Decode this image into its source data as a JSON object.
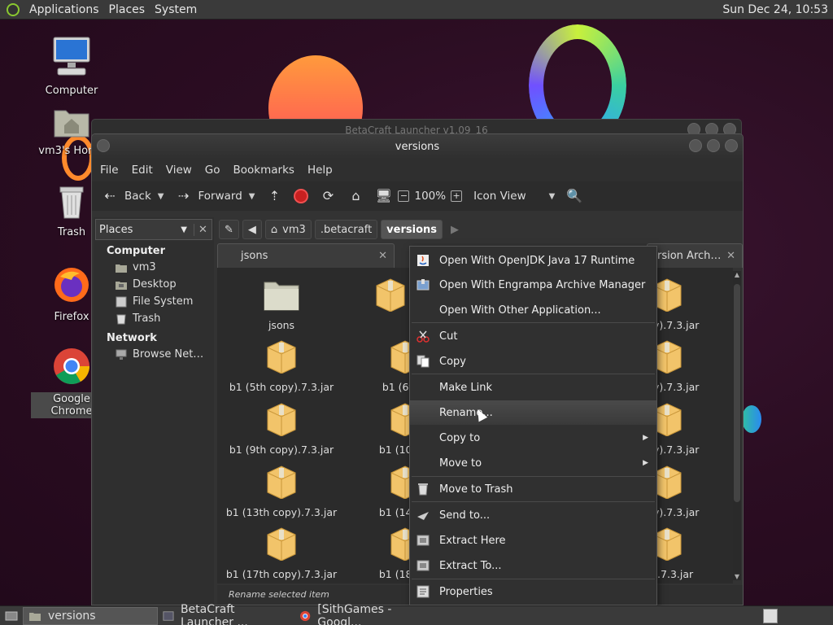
{
  "top_panel": {
    "menus": [
      "Applications",
      "Places",
      "System"
    ],
    "clock": "Sun Dec 24, 10:53"
  },
  "desktop_icons": [
    {
      "label": "Computer",
      "icon": "computer-icon"
    },
    {
      "label": "vm3's Home",
      "icon": "home-folder-icon"
    },
    {
      "label": "Trash",
      "icon": "trash-icon"
    },
    {
      "label": "Firefox",
      "icon": "firefox-icon"
    },
    {
      "label": "Google Chrome",
      "icon": "chrome-icon"
    }
  ],
  "back_window": {
    "title": "BetaCraft Launcher v1.09_16"
  },
  "file_manager": {
    "title": "versions",
    "menubar": [
      "File",
      "Edit",
      "View",
      "Go",
      "Bookmarks",
      "Help"
    ],
    "toolbar": {
      "back": "Back",
      "forward": "Forward",
      "zoom": "100%",
      "view_mode": "Icon View"
    },
    "sidebar": {
      "selector": "Places",
      "groups": [
        {
          "title": "Computer",
          "items": [
            "vm3",
            "Desktop",
            "File System",
            "Trash"
          ]
        },
        {
          "title": "Network",
          "items": [
            "Browse Net…"
          ]
        }
      ]
    },
    "path": [
      "vm3",
      ".betacraft",
      "versions"
    ],
    "tabs": [
      "jsons",
      "rsion Arch…"
    ],
    "files": [
      [
        "jsons",
        "b1.7",
        "copy).7.3.jar"
      ],
      [
        "b1 (5th copy).7.3.jar",
        "b1 (6th c",
        "copy).7.3.jar"
      ],
      [
        "b1 (9th copy).7.3.jar",
        "b1 (10th c",
        "copy).7.3.jar"
      ],
      [
        "b1 (13th copy).7.3.jar",
        "b1 (14th c",
        "copy).7.3.jar"
      ],
      [
        "b1 (17th copy).7.3.jar",
        "b1 (18th c",
        "py).7.3.jar"
      ]
    ],
    "status": "Rename selected item"
  },
  "context_menu": {
    "items": [
      {
        "label": "Open With OpenJDK Java 17 Runtime",
        "icon": "java-icon"
      },
      {
        "label": "Open With Engrampa Archive Manager",
        "icon": "archive-icon"
      },
      {
        "label": "Open With Other Application...",
        "icon": ""
      },
      {
        "label": "Cut",
        "icon": "scissors-icon"
      },
      {
        "label": "Copy",
        "icon": "copy-icon"
      },
      {
        "label": "Make Link",
        "icon": ""
      },
      {
        "label": "Rename...",
        "icon": "",
        "highlighted": true
      },
      {
        "label": "Copy to",
        "icon": "",
        "submenu": true
      },
      {
        "label": "Move to",
        "icon": "",
        "submenu": true
      },
      {
        "label": "Move to Trash",
        "icon": "trash-icon"
      },
      {
        "label": "Send to...",
        "icon": "send-icon"
      },
      {
        "label": "Extract Here",
        "icon": "extract-icon"
      },
      {
        "label": "Extract To...",
        "icon": "extract-icon"
      },
      {
        "label": "Properties",
        "icon": "properties-icon"
      }
    ]
  },
  "taskbar": [
    {
      "label": "versions",
      "active": true
    },
    {
      "label": "BetaCraft Launcher ...",
      "active": false
    },
    {
      "label": "[SithGames - Googl...",
      "active": false
    }
  ],
  "colors": {
    "panel_bg": "#3a3a3a",
    "window_bg": "#333333",
    "menu_highlight": "#4a4a4a",
    "folder_tan": "#f2c46a"
  }
}
